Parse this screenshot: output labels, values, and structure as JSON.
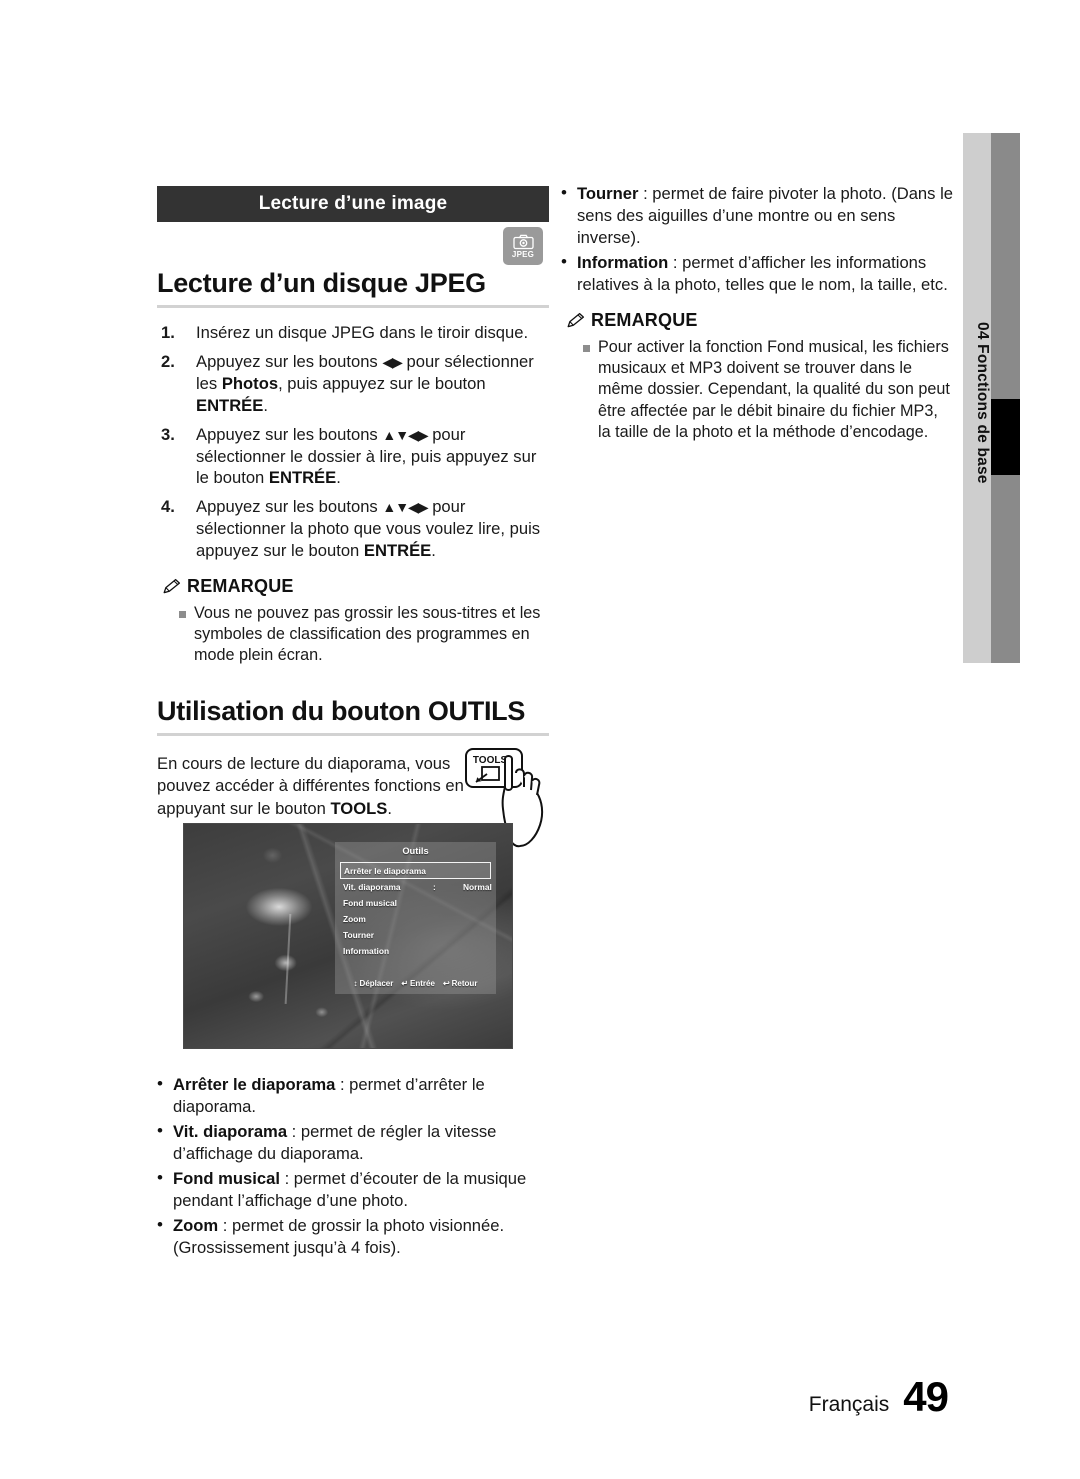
{
  "sidebar": {
    "chapter_number": "04",
    "chapter_title": "Fonctions de base",
    "vertical_label": "04  Fonctions de base",
    "band_color": "#cecece",
    "dark_band_color": "#8a8a8a",
    "marker_color": "#000000"
  },
  "section": {
    "banner": "Lecture d’une image",
    "banner_bg": "#333333",
    "badge": {
      "icon": "camera-icon",
      "label": "JPEG",
      "bg": "#9a9a9a"
    }
  },
  "headings": {
    "jpeg_disc": "Lecture d’un disque JPEG",
    "tools_button": "Utilisation du bouton OUTILS"
  },
  "steps": [
    {
      "num": "1.",
      "parts": [
        {
          "t": "Insérez un disque JPEG dans le tiroir disque.",
          "b": false
        }
      ]
    },
    {
      "num": "2.",
      "parts": [
        {
          "t": "Appuyez sur les boutons ",
          "b": false
        },
        {
          "t": "◀▶",
          "b": false,
          "arrows": true
        },
        {
          "t": " pour sélectionner les ",
          "b": false
        },
        {
          "t": "Photos",
          "b": true
        },
        {
          "t": ", puis appuyez sur le bouton ",
          "b": false
        },
        {
          "t": "ENTRÉE",
          "b": true
        },
        {
          "t": ".",
          "b": false
        }
      ]
    },
    {
      "num": "3.",
      "parts": [
        {
          "t": "Appuyez sur les boutons ",
          "b": false
        },
        {
          "t": "▲▼◀▶",
          "b": false,
          "arrows": true
        },
        {
          "t": " pour sélectionner le dossier à lire, puis appuyez sur le bouton ",
          "b": false
        },
        {
          "t": "ENTRÉE",
          "b": true
        },
        {
          "t": ".",
          "b": false
        }
      ]
    },
    {
      "num": "4.",
      "parts": [
        {
          "t": "Appuyez sur les boutons ",
          "b": false
        },
        {
          "t": "▲▼◀▶",
          "b": false,
          "arrows": true
        },
        {
          "t": " pour sélectionner la photo que vous voulez lire, puis appuyez sur le bouton ",
          "b": false
        },
        {
          "t": "ENTRÉE",
          "b": true
        },
        {
          "t": ".",
          "b": false
        }
      ]
    }
  ],
  "note_left": {
    "icon": "pencil-icon",
    "title": "REMARQUE",
    "items": [
      "Vous ne pouvez pas grossir les sous-titres et les symboles de classification des programmes en mode plein écran."
    ]
  },
  "tools_intro": {
    "parts": [
      {
        "t": "En cours de lecture du diaporama, vous pouvez accéder à différentes fonctions en appuyant sur le bouton ",
        "b": false
      },
      {
        "t": "TOOLS",
        "b": true
      },
      {
        "t": ".",
        "b": false
      }
    ],
    "button_art_label": "TOOLS"
  },
  "tv_screenshot": {
    "alt": "photo en niveaux de gris d’une fleur avec le menu Outils superposé",
    "osd": {
      "title": "Outils",
      "items": [
        {
          "label": "Arrêter le diaporama",
          "value": "",
          "colon": false,
          "selected": true
        },
        {
          "label": "Vit. diaporama",
          "value": "Normal",
          "colon": true,
          "selected": false
        },
        {
          "label": "Fond musical",
          "value": "",
          "colon": false,
          "selected": false
        },
        {
          "label": "Zoom",
          "value": "",
          "colon": false,
          "selected": false
        },
        {
          "label": "Tourner",
          "value": "",
          "colon": false,
          "selected": false
        },
        {
          "label": "Information",
          "value": "",
          "colon": false,
          "selected": false
        }
      ],
      "footer": [
        {
          "icon": "updown-arrow-icon",
          "label": "Déplacer"
        },
        {
          "icon": "enter-icon",
          "label": "Entrée"
        },
        {
          "icon": "return-icon",
          "label": "Retour"
        }
      ]
    }
  },
  "tools_options": [
    {
      "parts": [
        {
          "t": "Arrêter le diaporama",
          "b": true
        },
        {
          "t": " : permet d’arrêter le diaporama.",
          "b": false
        }
      ]
    },
    {
      "parts": [
        {
          "t": "Vit. diaporama",
          "b": true
        },
        {
          "t": " : permet de régler la vitesse d’affichage du diaporama.",
          "b": false
        }
      ]
    },
    {
      "parts": [
        {
          "t": "Fond musical",
          "b": true
        },
        {
          "t": " : permet d’écouter de la musique pendant l’affichage d’une photo.",
          "b": false
        }
      ]
    },
    {
      "parts": [
        {
          "t": "Zoom",
          "b": true
        },
        {
          "t": " : permet de grossir la photo visionnée. (Grossissement jusqu’à 4 fois).",
          "b": false
        }
      ]
    },
    {
      "parts": [
        {
          "t": "Tourner",
          "b": true
        },
        {
          "t": " : permet de faire pivoter la photo. (Dans le sens des aiguilles d’une montre ou en sens inverse).",
          "b": false
        }
      ]
    },
    {
      "parts": [
        {
          "t": "Information",
          "b": true
        },
        {
          "t": " : permet d’afficher les informations relatives à la photo, telles que le nom, la taille, etc.",
          "b": false
        }
      ]
    }
  ],
  "note_right": {
    "icon": "pencil-icon",
    "title": "REMARQUE",
    "items": [
      "Pour activer la fonction Fond musical, les fichiers musicaux et MP3 doivent se trouver dans le même dossier. Cependant, la qualité du son peut être affectée par le débit binaire du fichier MP3, la taille de la photo et la méthode d’encodage."
    ]
  },
  "footer": {
    "language": "Français",
    "page_number": "49"
  }
}
